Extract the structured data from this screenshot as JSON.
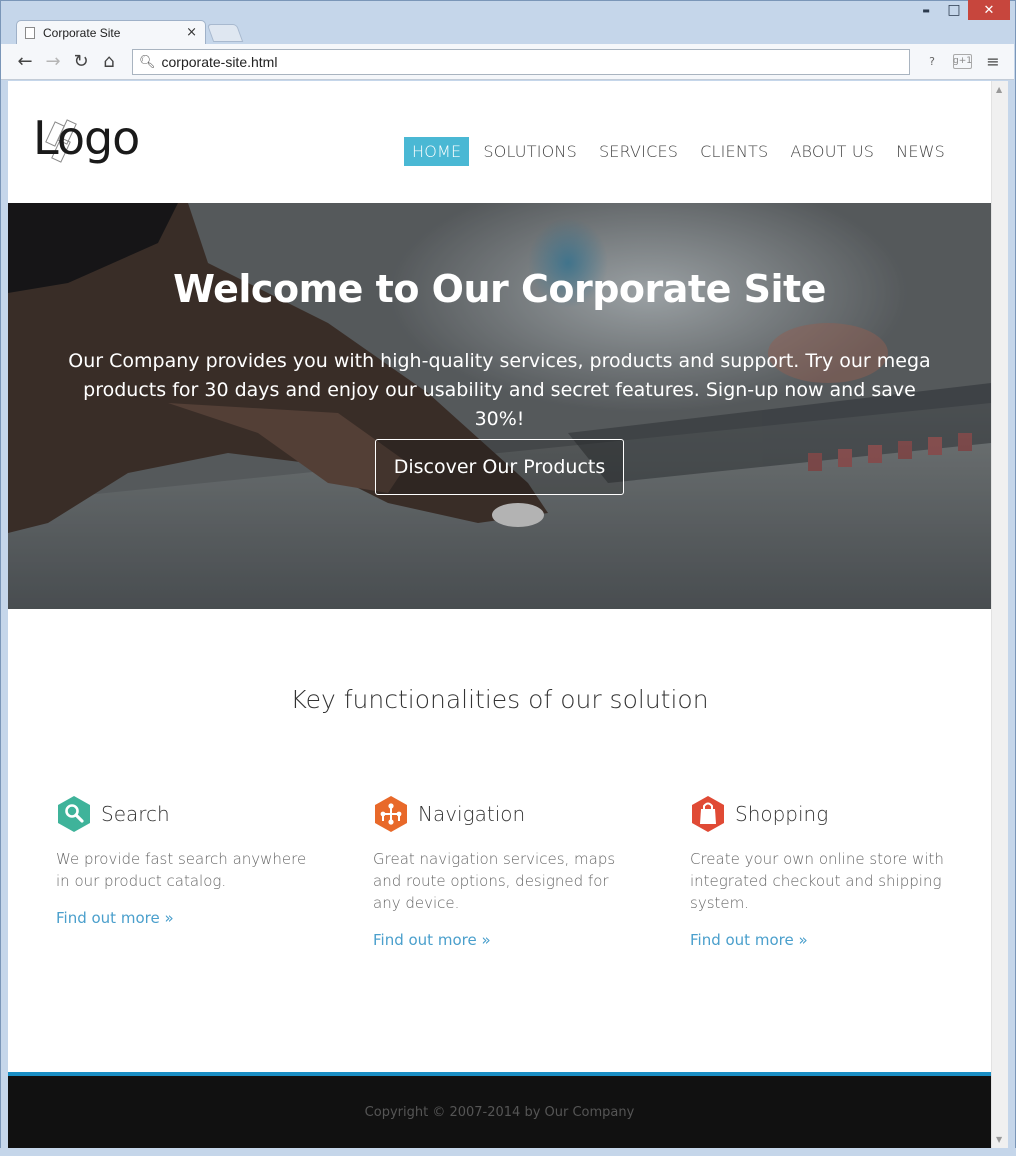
{
  "browser": {
    "tab_title": "Corporate Site",
    "tab_close": "×",
    "url": "corporate-site.html",
    "window_controls": {
      "minimize": "▬",
      "maximize": "□",
      "close": "✕"
    },
    "nav": {
      "back": "←",
      "forward": "→",
      "reload": "↻",
      "home": "⌂"
    },
    "extensions": {
      "help": "?",
      "gplus": "g+1",
      "menu": "≡"
    }
  },
  "header": {
    "logo_text": "Logo",
    "nav": [
      {
        "label": "HOME",
        "active": true
      },
      {
        "label": "SOLUTIONS"
      },
      {
        "label": "SERVICES"
      },
      {
        "label": "CLIENTS"
      },
      {
        "label": "ABOUT US"
      },
      {
        "label": "NEWS"
      }
    ]
  },
  "hero": {
    "title": "Welcome to Our Corporate Site",
    "text": "Our Company provides you with high-quality services, products and support. Try our mega products for 30 days and enjoy our usability and secret features. Sign-up now and save 30%!",
    "button": "Discover Our Products"
  },
  "features": {
    "title": "Key functionalities of our solution",
    "items": [
      {
        "icon": "search-icon",
        "color": "#3fb39a",
        "title": "Search",
        "desc": "We provide fast search anywhere in our product catalog.",
        "link": "Find out more »"
      },
      {
        "icon": "navigation-icon",
        "color": "#e8692a",
        "title": "Navigation",
        "desc": "Great navigation services, maps and route options, designed for any device.",
        "link": "Find out more »"
      },
      {
        "icon": "shopping-bag-icon",
        "color": "#e04a35",
        "title": "Shopping",
        "desc": "Create your own online store with integrated checkout and shipping system.",
        "link": "Find out more »"
      }
    ]
  },
  "footer": {
    "copyright": "Copyright © 2007-2014 by Our Company"
  },
  "colors": {
    "accent": "#4ab8d4",
    "link": "#4a9fcc",
    "footer_bg": "#111111",
    "footer_border": "#1a8ec4"
  }
}
